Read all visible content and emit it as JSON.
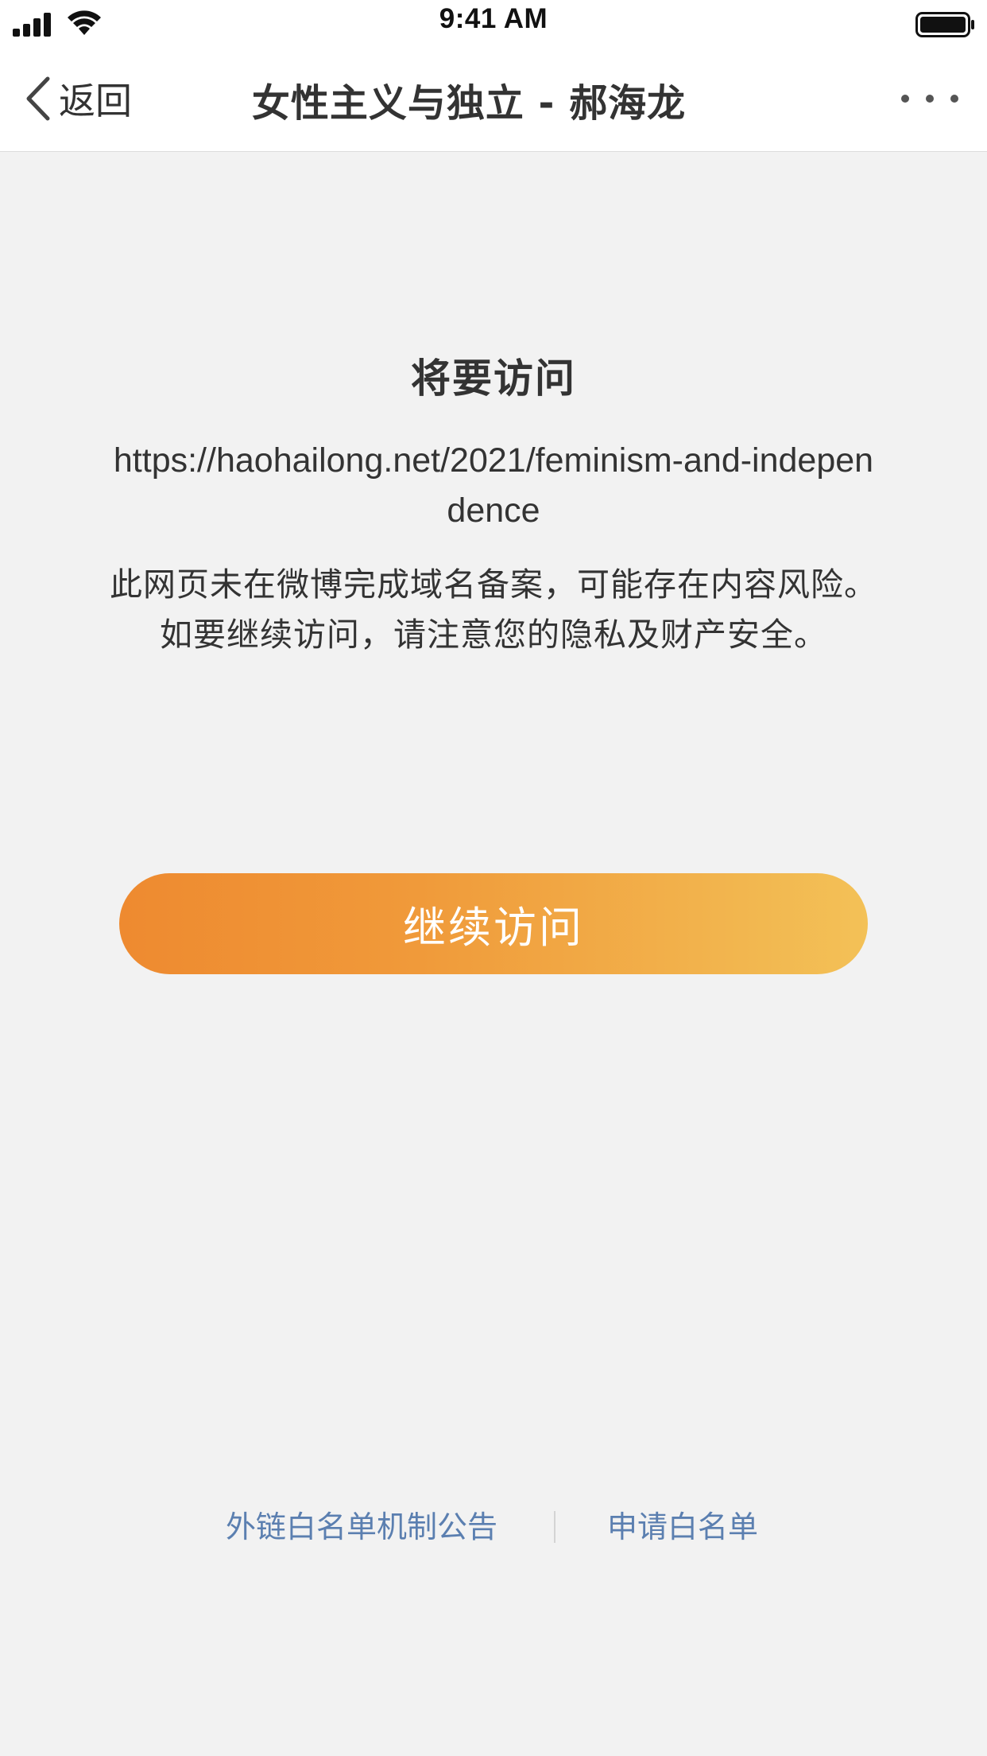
{
  "status_bar": {
    "time": "9:41 AM",
    "icons": [
      "signal-icon",
      "wifi-icon",
      "battery-icon"
    ]
  },
  "nav": {
    "back_label": "返回",
    "title": "女性主义与独立 - 郝海龙",
    "icons": [
      "chevron-left-icon",
      "more-icon"
    ]
  },
  "main": {
    "headline": "将要访问",
    "url": "https://haohailong.net/2021/feminism-and-independence",
    "warning_line1": "此网页未在微博完成域名备案，可能存在内容风险。",
    "warning_line2": "如要继续访问，请注意您的隐私及财产安全。",
    "continue_label": "继续访问"
  },
  "footer": {
    "link_notice": "外链白名单机制公告",
    "link_apply": "申请白名单"
  },
  "colors": {
    "background": "#f2f2f2",
    "button_gradient_start": "#ee8a30",
    "button_gradient_end": "#f3c157",
    "link": "#5b7fb0"
  }
}
